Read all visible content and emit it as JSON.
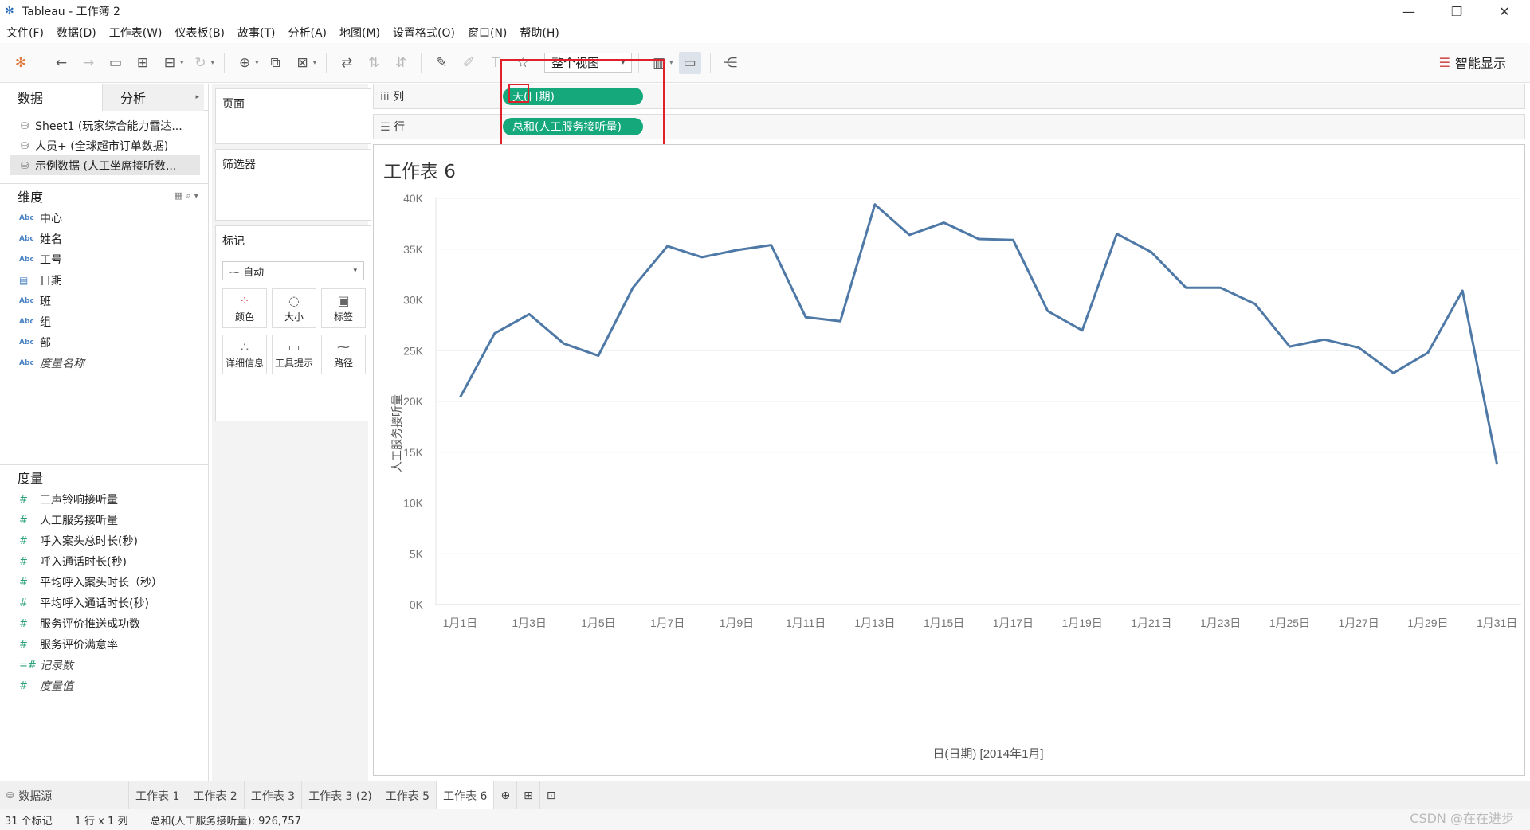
{
  "window": {
    "title": "Tableau - 工作簿 2"
  },
  "menu": [
    "文件(F)",
    "数据(D)",
    "工作表(W)",
    "仪表板(B)",
    "故事(T)",
    "分析(A)",
    "地图(M)",
    "设置格式(O)",
    "窗口(N)",
    "帮助(H)"
  ],
  "toolbar": {
    "view_mode": "整个视图",
    "show_me_label": "智能显示"
  },
  "left": {
    "tab_data": "数据",
    "tab_analysis": "分析",
    "datasources": [
      "Sheet1 (玩家综合能力雷达...",
      "人员+ (全球超市订单数据)",
      "示例数据 (人工坐席接听数..."
    ],
    "dimensions_title": "维度",
    "dimensions": [
      {
        "type": "Abc",
        "name": "中心"
      },
      {
        "type": "Abc",
        "name": "姓名"
      },
      {
        "type": "Abc",
        "name": "工号"
      },
      {
        "type": "date",
        "name": "日期"
      },
      {
        "type": "Abc",
        "name": "班"
      },
      {
        "type": "Abc",
        "name": "组"
      },
      {
        "type": "Abc",
        "name": "部"
      },
      {
        "type": "Abc",
        "name": "度量名称"
      }
    ],
    "measures_title": "度量",
    "measures": [
      "三声铃响接听量",
      "人工服务接听量",
      "呼入案头总时长(秒)",
      "呼入通话时长(秒)",
      "平均呼入案头时长（秒）",
      "平均呼入通话时长(秒)",
      "服务评价推送成功数",
      "服务评价满意率",
      "记录数",
      "度量值"
    ]
  },
  "cards": {
    "pages": "页面",
    "filters": "筛选器",
    "marks": "标记",
    "mark_type": "自动",
    "mark_buttons": [
      "颜色",
      "大小",
      "标签",
      "详细信息",
      "工具提示",
      "路径"
    ]
  },
  "shelves": {
    "columns_label": "列",
    "columns_pill": "天(日期)",
    "rows_label": "行",
    "rows_pill": "总和(人工服务接听量)"
  },
  "sheet": {
    "title": "工作表 6"
  },
  "chart_data": {
    "type": "line",
    "xlabel": "日(日期) [2014年1月]",
    "ylabel": "人工服务接听量",
    "x_ticks": [
      "1月1日",
      "1月3日",
      "1月5日",
      "1月7日",
      "1月9日",
      "1月11日",
      "1月13日",
      "1月15日",
      "1月17日",
      "1月19日",
      "1月21日",
      "1月23日",
      "1月25日",
      "1月27日",
      "1月29日",
      "1月31日"
    ],
    "y_ticks": [
      "0K",
      "5K",
      "10K",
      "15K",
      "20K",
      "25K",
      "30K",
      "35K",
      "40K"
    ],
    "ylim": [
      0,
      40000
    ],
    "x": [
      1,
      2,
      3,
      4,
      5,
      6,
      7,
      8,
      9,
      10,
      11,
      12,
      13,
      14,
      15,
      16,
      17,
      18,
      19,
      20,
      21,
      22,
      23,
      24,
      25,
      26,
      27,
      28,
      29,
      30,
      31
    ],
    "values": [
      20400,
      26700,
      28600,
      25700,
      24500,
      31200,
      35300,
      34200,
      34900,
      35400,
      28300,
      27900,
      39400,
      36400,
      37600,
      36000,
      35900,
      28900,
      27000,
      36500,
      34700,
      31200,
      31200,
      29600,
      25400,
      26100,
      25300,
      22800,
      24800,
      30900,
      13800
    ],
    "line_color": "#4e79a7",
    "grid": true
  },
  "bottom_tabs": {
    "datasource": "数据源",
    "sheets": [
      "工作表 1",
      "工作表 2",
      "工作表 3",
      "工作表 3 (2)",
      "工作表 5",
      "工作表 6"
    ],
    "active": "工作表 6"
  },
  "status": {
    "marks": "31 个标记",
    "dims": "1 行 x 1 列",
    "sum": "总和(人工服务接听量): 926,757"
  },
  "watermark": "CSDN @在在进步"
}
